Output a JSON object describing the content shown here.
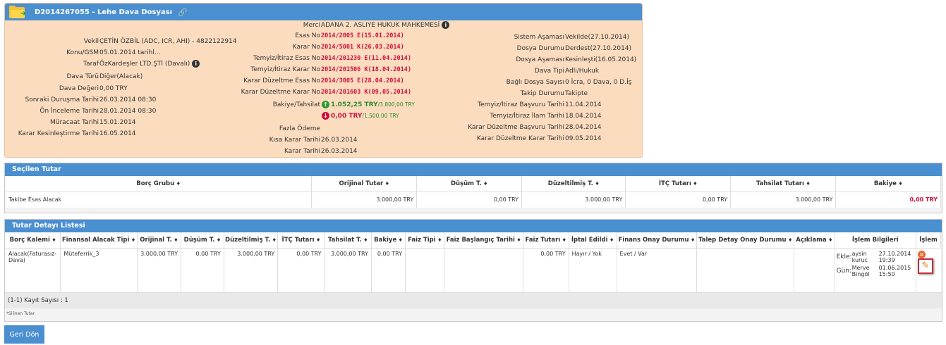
{
  "dosya": {
    "title": "D2014267055 - Lehe Dava Dosyası",
    "left": [
      {
        "label": "Vekil",
        "value": "ÇETİN ÖZBİL (ADC, ICR, AHI) - 4822122914"
      },
      {
        "label": "Konu/GSM",
        "value": "05.01.2014 tarihl..."
      },
      {
        "label": "Taraf",
        "value": "ÖzKardeşler LTD.ŞTİ  (Davalı)"
      },
      {
        "label": "Dava Türü",
        "value": "Diğer(Alacak)"
      },
      {
        "label": "Dava Değeri",
        "value": "0,00 TRY"
      },
      {
        "label": "Sonraki Duruşma Tarihi",
        "value": "26.03.2014 08:30"
      },
      {
        "label": "Ön İnceleme Tarihi",
        "value": "28.01.2014 08:30"
      },
      {
        "label": "Müracaat Tarihi",
        "value": "15.01.2014"
      },
      {
        "label": "Karar Kesinleştirme Tarihi",
        "value": "16.05.2014"
      }
    ],
    "mid": [
      {
        "label": "Merci",
        "value": "ADANA 2. ASLIYE HUKUK MAHKEMESİ"
      },
      {
        "label": "Esas No",
        "value": "2014/2005 E(15.01.2014)"
      },
      {
        "label": "Karar No",
        "value": "2014/5001 K(26.03.2014)"
      },
      {
        "label": "Temyiz/İtiraz Esas No",
        "value": "2014/201230 E(11.04.2014)"
      },
      {
        "label": "Temyiz/İtiraz Karar No",
        "value": "2014/201506 K(18.04.2014)"
      },
      {
        "label": "Karar Düzeltme Esas No",
        "value": "2014/3005 E(28.04.2014)"
      },
      {
        "label": "Karar Düzeltme Karar No",
        "value": "2014/201603 K(09.05.2014)"
      }
    ],
    "bakiye": {
      "label": "Bakiye/Tahsilat",
      "up_value": "1.052,25 TRY",
      "up_total": "/3.800,00 TRY",
      "down_value": "0,00 TRY",
      "down_total": "/1.500,00 TRY"
    },
    "mid_bottom": [
      {
        "label": "Fazla Ödeme",
        "value": ""
      },
      {
        "label": "Kısa Karar Tarihi",
        "value": "26.03.2014"
      },
      {
        "label": "Karar Tarihi",
        "value": "26.03.2014"
      }
    ],
    "right": [
      {
        "label": "Sistem Aşaması",
        "value": "Vekilde(27.10.2014)"
      },
      {
        "label": "Dosya Durumu",
        "value": "Derdest(27.10.2014)"
      },
      {
        "label": "Dosya Aşaması",
        "value": "Kesinleşti(16.05.2014)"
      },
      {
        "label": "Dava Tipi",
        "value": "Adli/Hukuk"
      },
      {
        "label": "Bağlı Dosya Sayısı",
        "value": "0 İcra, 0 Dava, 0 D.İş"
      },
      {
        "label": "Takip Durumu",
        "value": "Takipte"
      },
      {
        "label": "Temyiz/İtiraz Başvuru Tarihi",
        "value": "11.04.2014"
      },
      {
        "label": "Temyiz/İtiraz İlam Tarihi",
        "value": "18.04.2014"
      },
      {
        "label": "Karar Düzeltme Başvuru Tarihi",
        "value": "28.04.2014"
      },
      {
        "label": "Karar Düzeltme Karar Tarihi",
        "value": "09.05.2014"
      }
    ]
  },
  "secilen": {
    "title": "Seçilen Tutar",
    "headers": [
      "Borç Grubu",
      "Orijinal Tutar",
      "Düşüm T.",
      "Düzeltilmiş T.",
      "İTÇ Tutarı",
      "Tahsilat Tutarı",
      "Bakiye"
    ],
    "row": [
      "Takibe Esas Alacak",
      "3.000,00 TRY",
      "0,00 TRY",
      "3.000,00 TRY",
      "0,00 TRY",
      "3.000,00 TRY",
      "0,00 TRY"
    ]
  },
  "detay": {
    "title": "Tutar Detayı Listesi",
    "headers": [
      "Borç Kalemi",
      "Finansal Alacak Tipi",
      "Orijinal T.",
      "Düşüm T.",
      "Düzeltilmiş T.",
      "İTÇ Tutarı",
      "Tahsilat T.",
      "Bakiye",
      "Faiz Tipi",
      "Faiz Başlangıç Tarihi",
      "Faiz Tutarı",
      "İptal Edildi",
      "Finans Onay Durumu",
      "Talep Detay Onay Durumu",
      "Açıklama",
      "İşlem Bilgileri",
      "İşlem"
    ],
    "row": {
      "borc_kalemi": "Alacak(Faturasız-Dava)",
      "finansal_tip": "Müteferrik_3",
      "orijinal": "3.000,00 TRY",
      "dusum": "0,00 TRY",
      "duzeltilmis": "3.000,00 TRY",
      "itc": "0,00 TRY",
      "tahsilat": "3.000,00 TRY",
      "bakiye": "0,00 TRY",
      "faiz_tipi": "",
      "faiz_baslangic": "",
      "faiz_tutari": "0,00 TRY",
      "iptal": "Hayır / Yok",
      "finans_onay": "Evet / Var",
      "talep_onay": "",
      "aciklama": "",
      "ekle_label": "Ekle:",
      "ekle_user": "aysin kuruc",
      "ekle_date": "27.10.2014 19:39",
      "gun_label": "Gün:",
      "gun_user": "Merve Bingöl",
      "gun_date": "01.06.2015 15:50"
    },
    "footer": "(1-1) Kayıt Sayısı : 1",
    "note": "*Silinen Tutar"
  },
  "geri_label": "Geri Dön",
  "colors": {
    "header_blue": "#4a8fd0",
    "panel_bg": "#fbdcbf",
    "red_value": "#d0103a",
    "green_value": "#2e8b2e"
  }
}
